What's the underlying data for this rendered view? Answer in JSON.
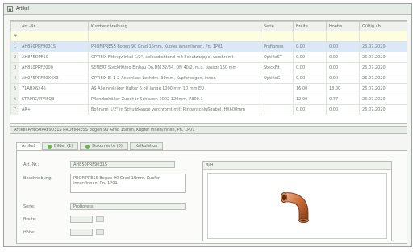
{
  "window": {
    "title": "Artikel"
  },
  "grid": {
    "columns": [
      "",
      "Art.-Nr.",
      "Kurzbeschreibung",
      "Serie",
      "Breite",
      "Hoehe",
      "Gültig ab"
    ],
    "rows": [
      {
        "rn": "1",
        "art": "AH850PRF9031S",
        "desc": "PROFIPRESS Bogen 90 Grad 15mm, Kupfer innen/innen, Pn. 1P01",
        "serie": "Profipress",
        "breite": "0,00",
        "hoehe": "0,00",
        "date": "26.07.2020"
      },
      {
        "rn": "2",
        "art": "AH875OPF10",
        "desc": "OPTIFIX Fittingwinkel 1/2\", selbstdichtend mit Schutzkappe, verchromt",
        "serie": "OptifixST",
        "breite": "0,00",
        "hoehe": "0,00",
        "date": "26.07.2020"
      },
      {
        "rn": "3",
        "art": "AH810PRF2000",
        "desc": "SENERT Steckfitting Einbau Dn.DN 32/34, DN 40/2, m.u. passgr.160 mm",
        "serie": "SteckFit",
        "breite": "0,00",
        "hoehe": "0,00",
        "date": "26.07.2020"
      },
      {
        "rn": "4",
        "art": "AH075PRF80X4X3",
        "desc": "OPTIFIX E. 1-2 Anschluss Lochdm. 30mm, Kupferbogen, innen",
        "serie": "OptifixG",
        "breite": "0,00",
        "hoehe": "0,00",
        "date": "26.07.2020"
      },
      {
        "rn": "5",
        "art": "71AHX6X45",
        "desc": "AS Alleinreiniger Halter 6 bit lange 1000 mm 10 mm EU",
        "serie": "",
        "breite": "16,00",
        "hoehe": "18,00",
        "date": "26.07.2020"
      },
      {
        "rn": "6",
        "art": "STRPRC/FP45Q3",
        "desc": "Pflanzbehälter Zubehör Schlauch 3002 120mm, P300.1",
        "serie": "",
        "breite": "12,00",
        "hoehe": "0,77",
        "date": "26.07.2020"
      },
      {
        "rn": "7",
        "art": "AR+",
        "desc": "Bohrarm 1/2\" in Schutzkappe verchromt mit, Ringanschlußgabel, HX600mm",
        "serie": "",
        "breite": "0,00",
        "hoehe": "0,00",
        "date": "26.07.2020"
      }
    ]
  },
  "detail": {
    "header": "Artikel AH850PRF9031S PROFIPRESS Bogen 90 Grad 15mm, Kupfer innen/innen, Pn. 1P01",
    "tabs": [
      "Artikel",
      "Bilder (1)",
      "Dokumente (0)",
      "Kalkulation"
    ],
    "labels": {
      "art": "Art.-Nr.:",
      "desc": "Beschreibung:",
      "serie": "Serie:",
      "breite": "Breite:",
      "hoehe": "Höhe:",
      "image": "Bild"
    },
    "values": {
      "art": "AH850PRF9031S",
      "desc": "PROFIPRESS Bogen 90 Grad 15mm, Kupfer innen/innen, Pn. 1P01",
      "serie": "Profipress",
      "breite": "",
      "hoehe": ""
    }
  },
  "icons": {
    "title": "window-icon",
    "image": "copper-elbow-fitting-icon"
  }
}
